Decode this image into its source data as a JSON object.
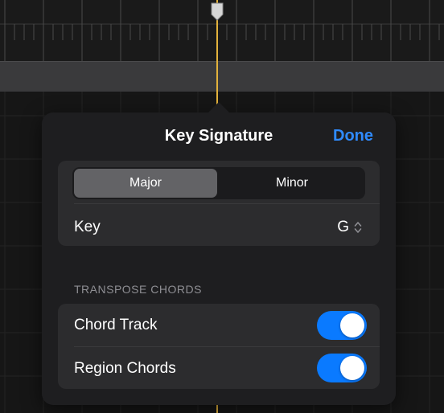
{
  "popover": {
    "title": "Key Signature",
    "done_label": "Done"
  },
  "scale": {
    "options": [
      "Major",
      "Minor"
    ],
    "selected": "Major"
  },
  "key": {
    "label": "Key",
    "value": "G"
  },
  "transpose": {
    "header": "TRANSPOSE CHORDS",
    "items": [
      {
        "label": "Chord Track",
        "enabled": true
      },
      {
        "label": "Region Chords",
        "enabled": true
      }
    ]
  },
  "colors": {
    "accent": "#0a7aff",
    "done": "#2f8bff",
    "playhead": "#e3b23c"
  }
}
